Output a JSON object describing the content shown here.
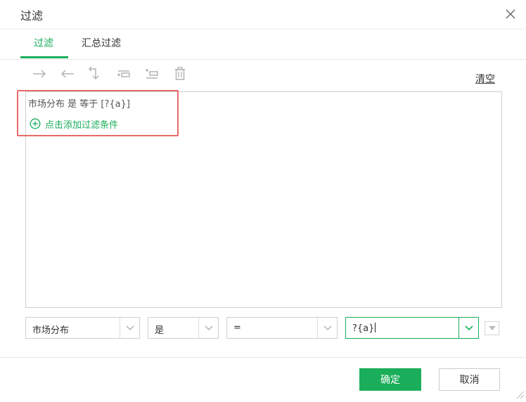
{
  "dialog": {
    "title": "过滤",
    "close_icon": "close-icon"
  },
  "tabs": [
    {
      "label": "过滤",
      "active": true
    },
    {
      "label": "汇总过滤",
      "active": false
    }
  ],
  "toolbar": {
    "icons": [
      "indent-right-icon",
      "indent-left-icon",
      "wrap-return-icon",
      "insert-above-icon",
      "insert-below-icon",
      "delete-icon"
    ],
    "clear_label": "清空"
  },
  "filter": {
    "condition": "市场分布 是 等于 [?{a}]",
    "add_label": "点击添加过滤条件"
  },
  "editor": {
    "field": "市场分布",
    "logic": "是",
    "operator": "=",
    "value": "?{a}"
  },
  "footer": {
    "ok_label": "确定",
    "cancel_label": "取消"
  },
  "colors": {
    "accent": "#1aae5a",
    "highlight": "#e86a6a",
    "border": "#cfcfcf"
  }
}
